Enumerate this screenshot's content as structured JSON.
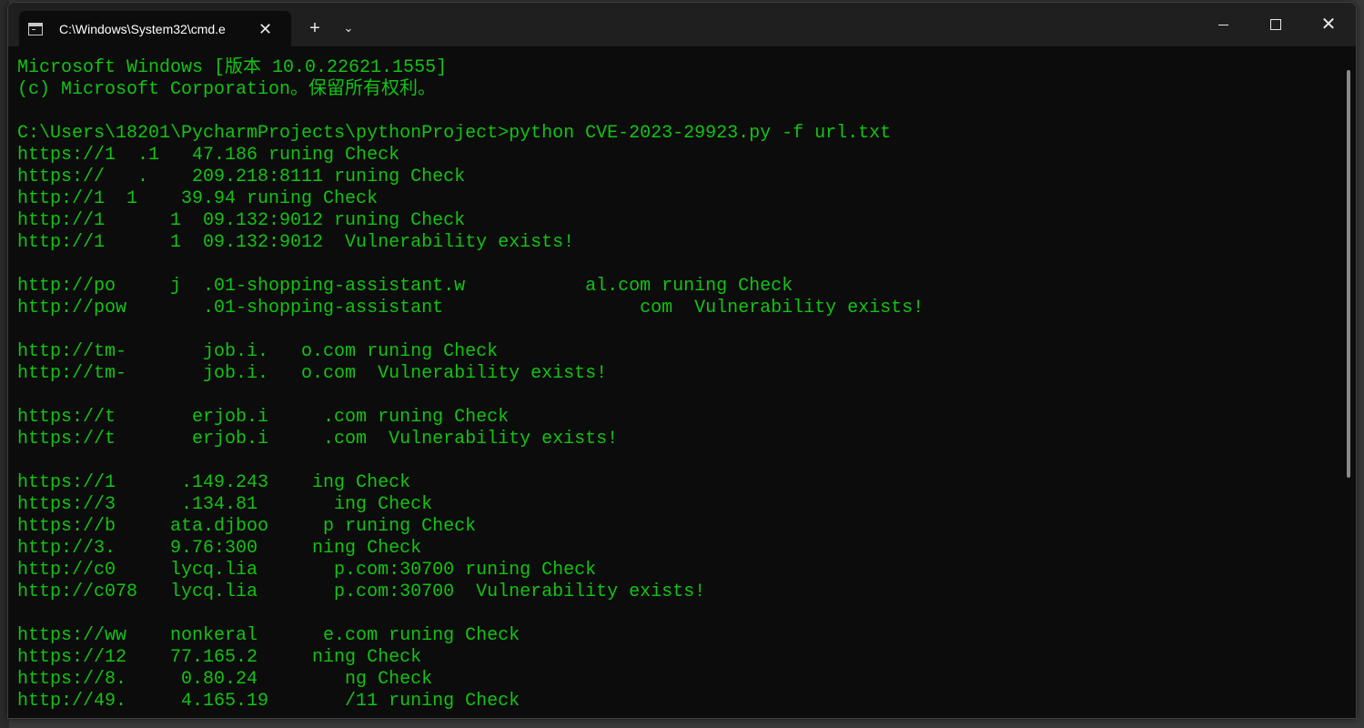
{
  "tab": {
    "title": "C:\\Windows\\System32\\cmd.e",
    "icon": "terminal-icon",
    "close_label": "✕"
  },
  "titlebar": {
    "new_tab_label": "+",
    "dropdown_label": "⌄",
    "close_label": "✕"
  },
  "colors": {
    "terminal_text": "#13c313",
    "terminal_bg": "#0c0c0c"
  },
  "terminal": {
    "lines": [
      "Microsoft Windows [版本 10.0.22621.1555]",
      "(c) Microsoft Corporation。保留所有权利。",
      "",
      "C:\\Users\\18201\\PycharmProjects\\pythonProject>python CVE-2023-29923.py -f url.txt",
      "https://1  .1   47.186 runing Check",
      "https://   .    209.218:8111 runing Check",
      "http://1  1    39.94 runing Check",
      "http://1      1  09.132:9012 runing Check",
      "http://1      1  09.132:9012  Vulnerability exists!",
      "",
      "http://po     j  .01-shopping-assistant.w           al.com runing Check",
      "http://pow       .01-shopping-assistant                  com  Vulnerability exists!",
      "",
      "http://tm-       job.i.   o.com runing Check",
      "http://tm-       job.i.   o.com  Vulnerability exists!",
      "",
      "https://t       erjob.i     .com runing Check",
      "https://t       erjob.i     .com  Vulnerability exists!",
      "",
      "https://1      .149.243    ing Check",
      "https://3      .134.81       ing Check",
      "https://b     ata.djboo     p runing Check",
      "http://3.     9.76:300     ning Check",
      "http://c0     lycq.lia       p.com:30700 runing Check",
      "http://c078   lycq.lia       p.com:30700  Vulnerability exists!",
      "",
      "https://ww    nonkeral      e.com runing Check",
      "https://12    77.165.2     ning Check",
      "https://8.     0.80.24        ng Check",
      "http://49.     4.165.19       /11 runing Check"
    ]
  }
}
